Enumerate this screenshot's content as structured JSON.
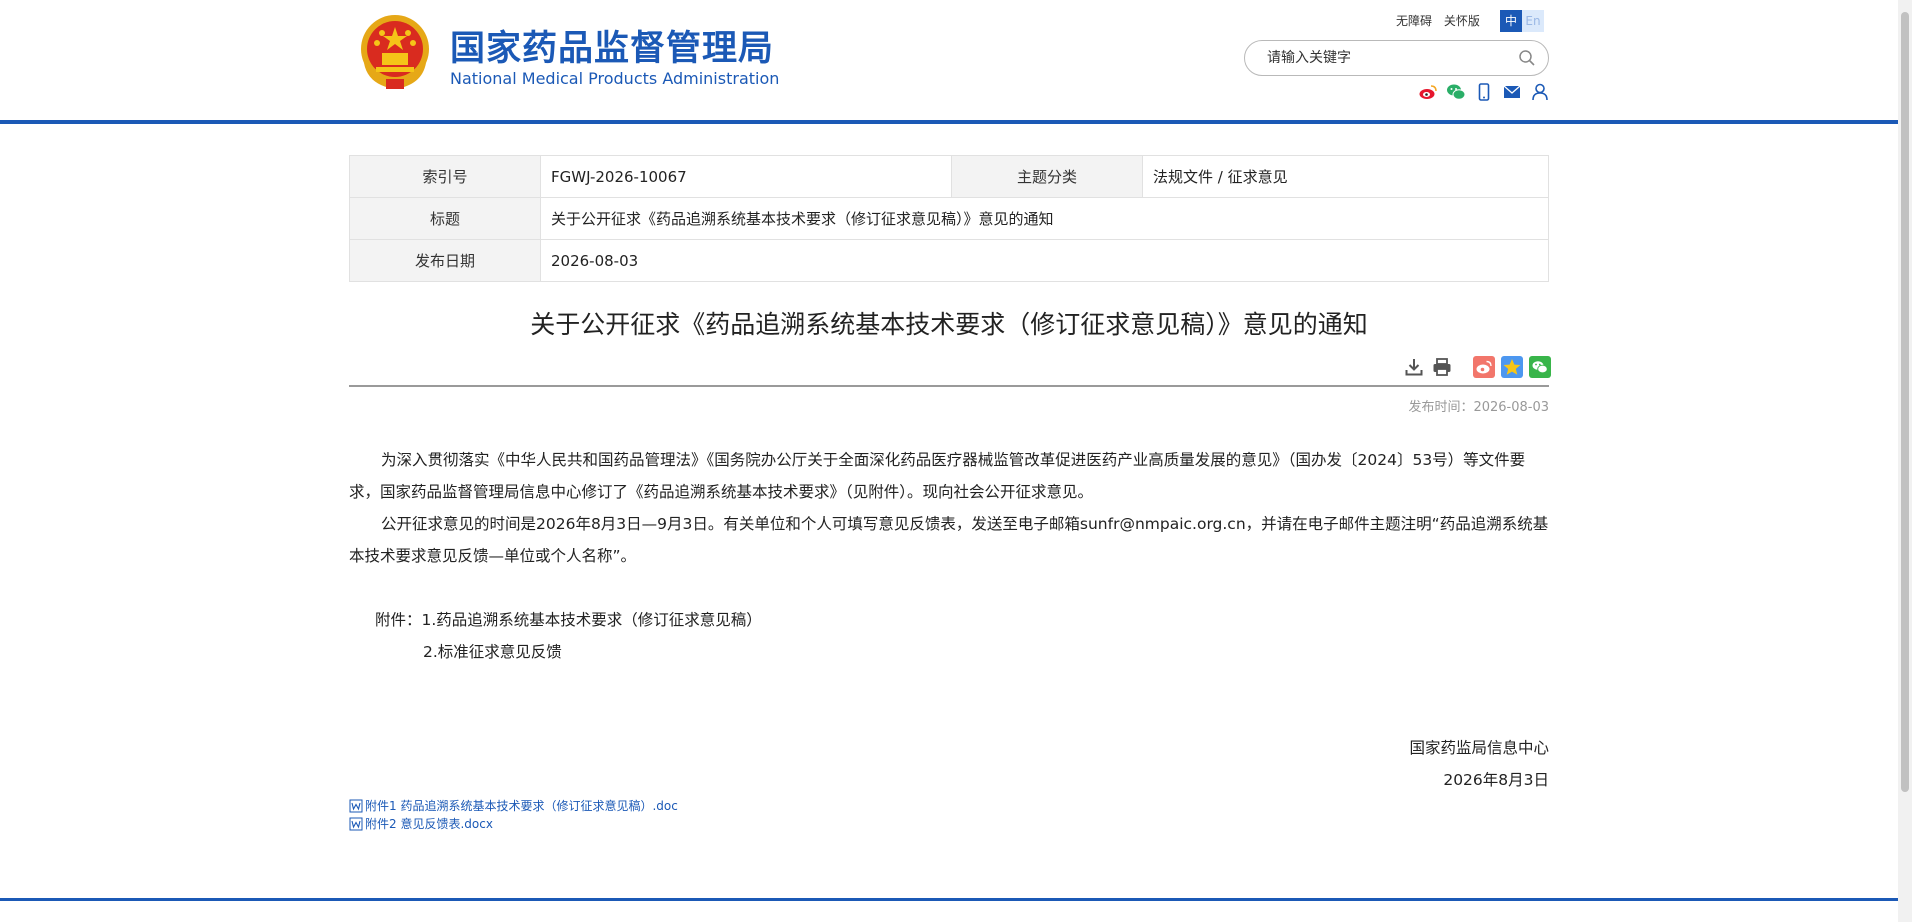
{
  "header": {
    "title_cn": "国家药品监督管理局",
    "title_en": "National Medical Products Administration",
    "links": [
      "无障碍",
      "关怀版"
    ],
    "lang_zh": "中",
    "lang_en": "En",
    "search_placeholder": "请输入关键字",
    "social_icons": [
      "weibo-icon",
      "wechat-icon",
      "mobile-icon",
      "mail-icon",
      "user-icon"
    ],
    "colors": {
      "brand": "#1b59b6"
    }
  },
  "info": {
    "index_label": "索引号",
    "index_value": "FGWJ-2026-10067",
    "category_label": "主题分类",
    "category_value": "法规文件 / 征求意见",
    "title_label": "标题",
    "title_value": "关于公开征求《药品追溯系统基本技术要求（修订征求意见稿）》意见的通知",
    "date_label": "发布日期",
    "date_value": "2026-08-03"
  },
  "article": {
    "title": "关于公开征求《药品追溯系统基本技术要求（修订征求意见稿）》意见的通知",
    "publish_time": "发布时间：2026-08-03",
    "para1": "为深入贯彻落实《中华人民共和国药品管理法》《国务院办公厅关于全面深化药品医疗器械监管改革促进医药产业高质量发展的意见》（国办发〔2024〕53号）等文件要求，国家药品监督管理局信息中心修订了《药品追溯系统基本技术要求》（见附件）。现向社会公开征求意见。",
    "para2": "公开征求意见的时间是2026年8月3日—9月3日。有关单位和个人可填写意见反馈表，发送至电子邮箱sunfr@nmpaic.org.cn，并请在电子邮件主题注明“药品追溯系统基本技术要求意见反馈—单位或个人名称”。",
    "attach_line1": "附件：1.药品追溯系统基本技术要求（修订征求意见稿）",
    "attach_line2": "2.标准征求意见反馈",
    "signer": "国家药监局信息中心",
    "sign_date": "2026年8月3日",
    "files": [
      "附件1 药品追溯系统基本技术要求（修订征求意见稿）.doc",
      "附件2 意见反馈表.docx"
    ]
  }
}
